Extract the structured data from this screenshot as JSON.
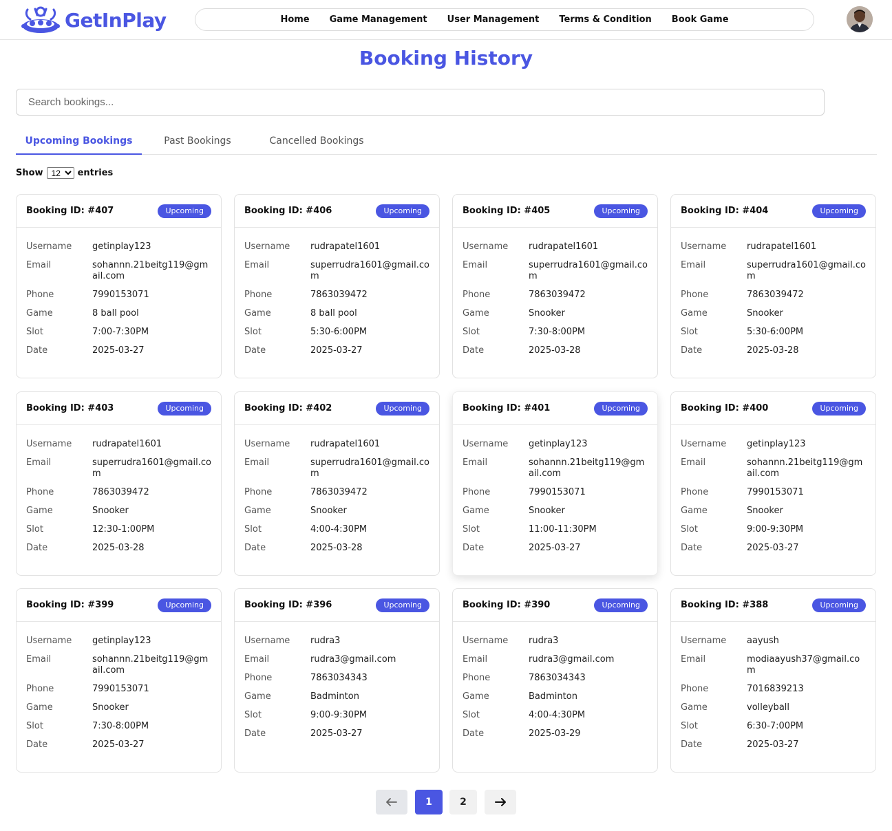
{
  "brand": {
    "name": "GetInPlay",
    "accent_color": "#4a56e2"
  },
  "nav": {
    "items": [
      {
        "label": "Home"
      },
      {
        "label": "Game Management"
      },
      {
        "label": "User Management"
      },
      {
        "label": "Terms & Condition"
      },
      {
        "label": "Book Game"
      }
    ]
  },
  "page": {
    "title": "Booking History"
  },
  "search": {
    "placeholder": "Search bookings..."
  },
  "tabs": [
    {
      "label": "Upcoming Bookings",
      "active": true
    },
    {
      "label": "Past Bookings",
      "active": false
    },
    {
      "label": "Cancelled Bookings",
      "active": false
    }
  ],
  "entries": {
    "show_label": "Show",
    "value": "12",
    "entries_label": "entries"
  },
  "field_labels": {
    "username": "Username",
    "email": "Email",
    "phone": "Phone",
    "game": "Game",
    "slot": "Slot",
    "date": "Date"
  },
  "bookings": [
    {
      "id": "Booking ID: #407",
      "status": "Upcoming",
      "username": "getinplay123",
      "email": "sohannn.21beitg119@gmail.com",
      "phone": "7990153071",
      "game": "8 ball pool",
      "slot": "7:00-7:30PM",
      "date": "2025-03-27"
    },
    {
      "id": "Booking ID: #406",
      "status": "Upcoming",
      "username": "rudrapatel1601",
      "email": "superrudra1601@gmail.com",
      "phone": "7863039472",
      "game": "8 ball pool",
      "slot": "5:30-6:00PM",
      "date": "2025-03-27"
    },
    {
      "id": "Booking ID: #405",
      "status": "Upcoming",
      "username": "rudrapatel1601",
      "email": "superrudra1601@gmail.com",
      "phone": "7863039472",
      "game": "Snooker",
      "slot": "7:30-8:00PM",
      "date": "2025-03-28"
    },
    {
      "id": "Booking ID: #404",
      "status": "Upcoming",
      "username": "rudrapatel1601",
      "email": "superrudra1601@gmail.com",
      "phone": "7863039472",
      "game": "Snooker",
      "slot": "5:30-6:00PM",
      "date": "2025-03-28"
    },
    {
      "id": "Booking ID: #403",
      "status": "Upcoming",
      "username": "rudrapatel1601",
      "email": "superrudra1601@gmail.com",
      "phone": "7863039472",
      "game": "Snooker",
      "slot": "12:30-1:00PM",
      "date": "2025-03-28"
    },
    {
      "id": "Booking ID: #402",
      "status": "Upcoming",
      "username": "rudrapatel1601",
      "email": "superrudra1601@gmail.com",
      "phone": "7863039472",
      "game": "Snooker",
      "slot": "4:00-4:30PM",
      "date": "2025-03-28"
    },
    {
      "id": "Booking ID: #401",
      "status": "Upcoming",
      "username": "getinplay123",
      "email": "sohannn.21beitg119@gmail.com",
      "phone": "7990153071",
      "game": "Snooker",
      "slot": "11:00-11:30PM",
      "date": "2025-03-27"
    },
    {
      "id": "Booking ID: #400",
      "status": "Upcoming",
      "username": "getinplay123",
      "email": "sohannn.21beitg119@gmail.com",
      "phone": "7990153071",
      "game": "Snooker",
      "slot": "9:00-9:30PM",
      "date": "2025-03-27"
    },
    {
      "id": "Booking ID: #399",
      "status": "Upcoming",
      "username": "getinplay123",
      "email": "sohannn.21beitg119@gmail.com",
      "phone": "7990153071",
      "game": "Snooker",
      "slot": "7:30-8:00PM",
      "date": "2025-03-27"
    },
    {
      "id": "Booking ID: #396",
      "status": "Upcoming",
      "username": "rudra3",
      "email": "rudra3@gmail.com",
      "phone": "7863034343",
      "game": "Badminton",
      "slot": "9:00-9:30PM",
      "date": "2025-03-27"
    },
    {
      "id": "Booking ID: #390",
      "status": "Upcoming",
      "username": "rudra3",
      "email": "rudra3@gmail.com",
      "phone": "7863034343",
      "game": "Badminton",
      "slot": "4:00-4:30PM",
      "date": "2025-03-29"
    },
    {
      "id": "Booking ID: #388",
      "status": "Upcoming",
      "username": "aayush",
      "email": "modiaayush37@gmail.com",
      "phone": "7016839213",
      "game": "volleyball",
      "slot": "6:30-7:00PM",
      "date": "2025-03-27"
    }
  ],
  "pagination": {
    "prev_icon": "arrow-left-icon",
    "pages": [
      "1",
      "2"
    ],
    "current": "1",
    "next_icon": "arrow-right-icon"
  }
}
